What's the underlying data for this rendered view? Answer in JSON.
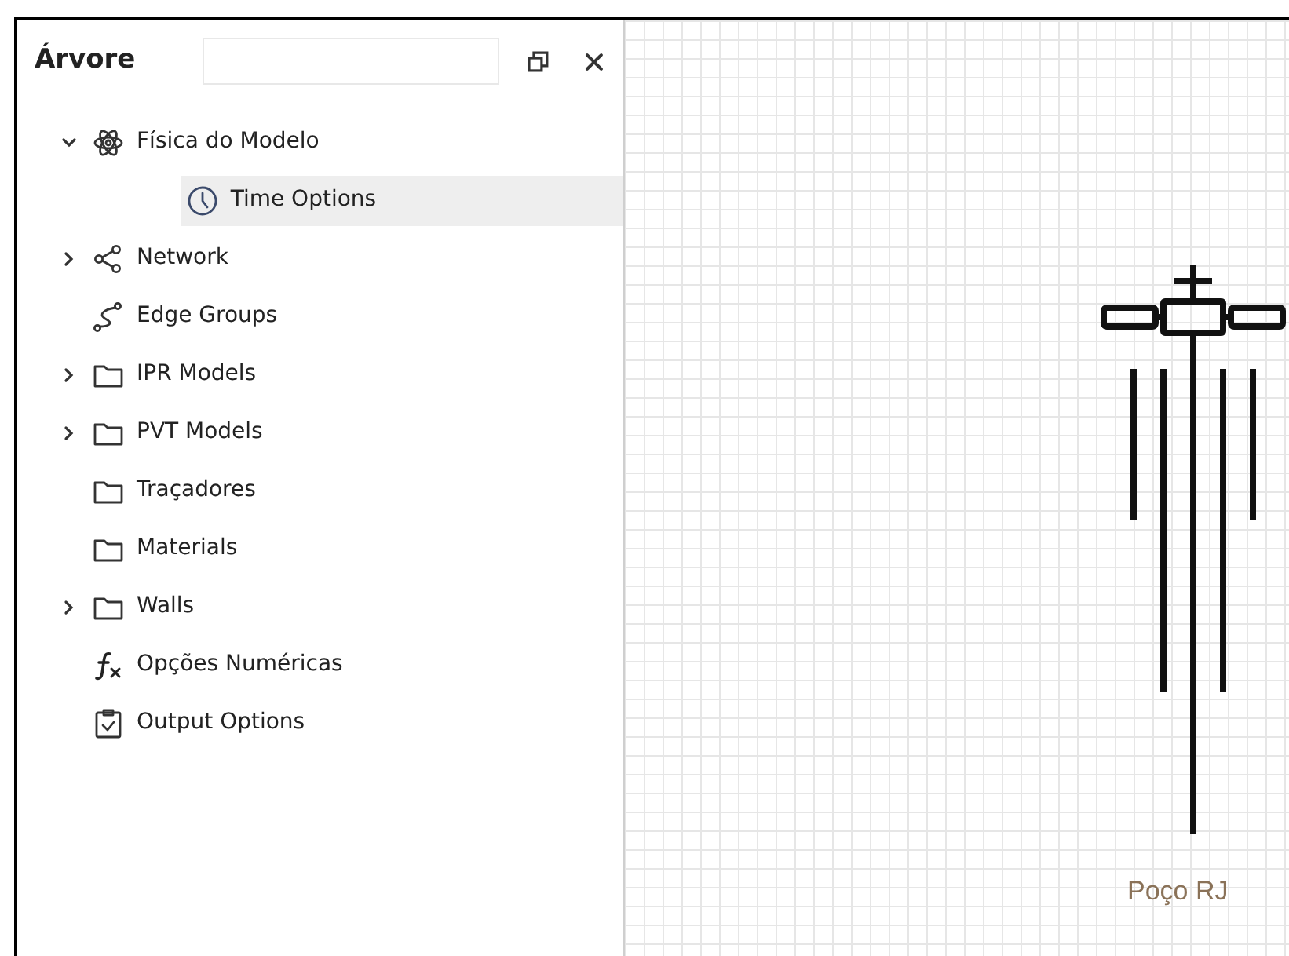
{
  "panel": {
    "title": "Árvore"
  },
  "tree": [
    {
      "label": "Física do Modelo",
      "kind": "atom",
      "expanded": true,
      "selected": false,
      "children": [
        {
          "label": "Time Options",
          "kind": "clock",
          "selected": true
        }
      ]
    },
    {
      "label": "Network",
      "kind": "network",
      "expanded": false,
      "selected": false
    },
    {
      "label": "Edge Groups",
      "kind": "edges",
      "selected": false
    },
    {
      "label": "IPR Models",
      "kind": "folder",
      "expanded": false,
      "selected": false
    },
    {
      "label": "PVT Models",
      "kind": "folder",
      "expanded": false,
      "selected": false
    },
    {
      "label": "Traçadores",
      "kind": "folder",
      "selected": false
    },
    {
      "label": "Materials",
      "kind": "folder",
      "selected": false
    },
    {
      "label": "Walls",
      "kind": "folder",
      "expanded": false,
      "selected": false
    },
    {
      "label": "Opções Numéricas",
      "kind": "function",
      "selected": false
    },
    {
      "label": "Output Options",
      "kind": "clipboard",
      "selected": false
    }
  ],
  "canvas": {
    "well": {
      "label": "Poço RJ"
    }
  }
}
